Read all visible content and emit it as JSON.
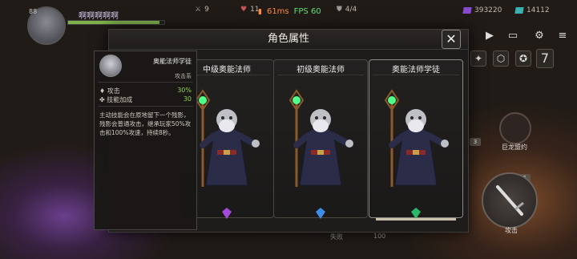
{
  "hud": {
    "level": "88",
    "player_name": "啊啊啊啊啊",
    "hp_fraction": 0.95,
    "stat_1": "9",
    "stat_2": "11",
    "ping": "61ms",
    "fps": "FPS 60",
    "progress": "4/4",
    "currency_purple": "393220",
    "currency_teal": "14112"
  },
  "panel": {
    "title": "角色属性",
    "close_icon": "close-icon"
  },
  "cards": [
    {
      "name": "中级奥能法师",
      "gem_color": "#a44ad8",
      "selected": false
    },
    {
      "name": "初级奥能法师",
      "gem_color": "#3a8ee8",
      "selected": false
    },
    {
      "name": "奥能法师学徒",
      "gem_color": "#2ab86a",
      "selected": true
    }
  ],
  "tooltip": {
    "name": "奥能法师学徒",
    "type": "攻击系",
    "attack_label": "攻击",
    "attack_value": "30%",
    "skill_label": "技能加成",
    "skill_value": "30",
    "description": "主动技能会在原地留下一个残影，残影会普通攻击，继承玩家50%攻击和100%攻速，持续8秒。"
  },
  "right_hud": {
    "skill_label": "巨龙盟约",
    "attack_label": "攻击",
    "badge_1": "3",
    "badge_2": "1",
    "number_7": "7"
  },
  "bottom": {
    "label_1": "失败",
    "label_2": "100"
  },
  "colors": {
    "accent_orange": "#ff8a3a",
    "fps_green": "#5fe07a",
    "stat_green": "#8fd14a"
  }
}
